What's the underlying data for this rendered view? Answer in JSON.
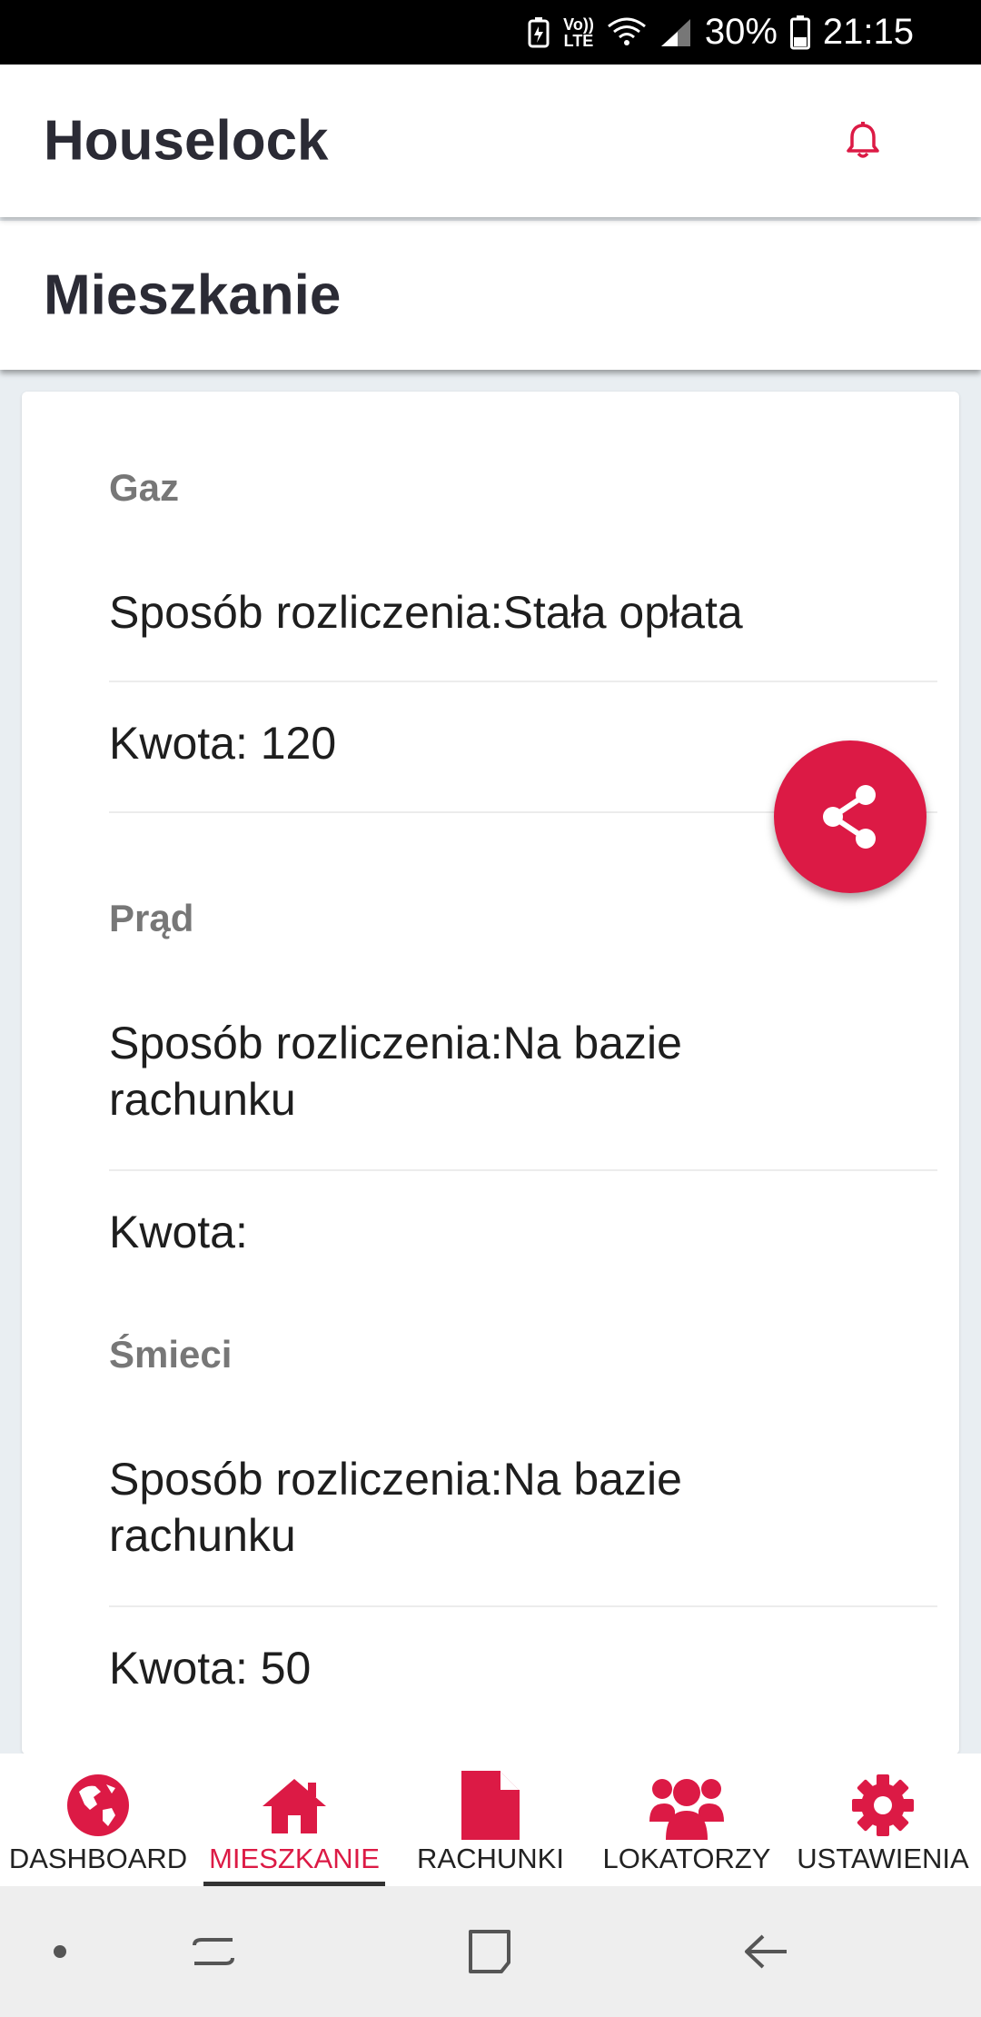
{
  "status_bar": {
    "lte_top": "Vo))",
    "lte_bottom": "LTE",
    "battery": "30%",
    "time": "21:15"
  },
  "app_bar": {
    "title": "Houselock",
    "notification_icon": "bell-icon"
  },
  "page": {
    "title": "Mieszkanie"
  },
  "sections": [
    {
      "title": "Gaz",
      "method": "Sposób rozliczenia:Stała opłata",
      "amount": "Kwota: 120"
    },
    {
      "title": "Prąd",
      "method_line1": "Sposób rozliczenia:Na bazie",
      "method_line2": "rachunku",
      "amount": "Kwota:"
    },
    {
      "title": "Śmieci",
      "method_line1": "Sposób rozliczenia:Na bazie",
      "method_line2": "rachunku",
      "amount": "Kwota: 50"
    }
  ],
  "fab": {
    "icon": "share-icon"
  },
  "bottom_nav": {
    "items": [
      {
        "label": "DASHBOARD",
        "icon": "globe-icon"
      },
      {
        "label": "MIESZKANIE",
        "icon": "home-icon",
        "active": true
      },
      {
        "label": "RACHUNKI",
        "icon": "file-icon"
      },
      {
        "label": "LOKATORZY",
        "icon": "users-icon"
      },
      {
        "label": "USTAWIENIA",
        "icon": "gear-icon"
      }
    ]
  },
  "colors": {
    "accent": "#dc1a45",
    "background": "#e9eef2",
    "title_text": "#2b2b35",
    "section_title": "#777777"
  }
}
